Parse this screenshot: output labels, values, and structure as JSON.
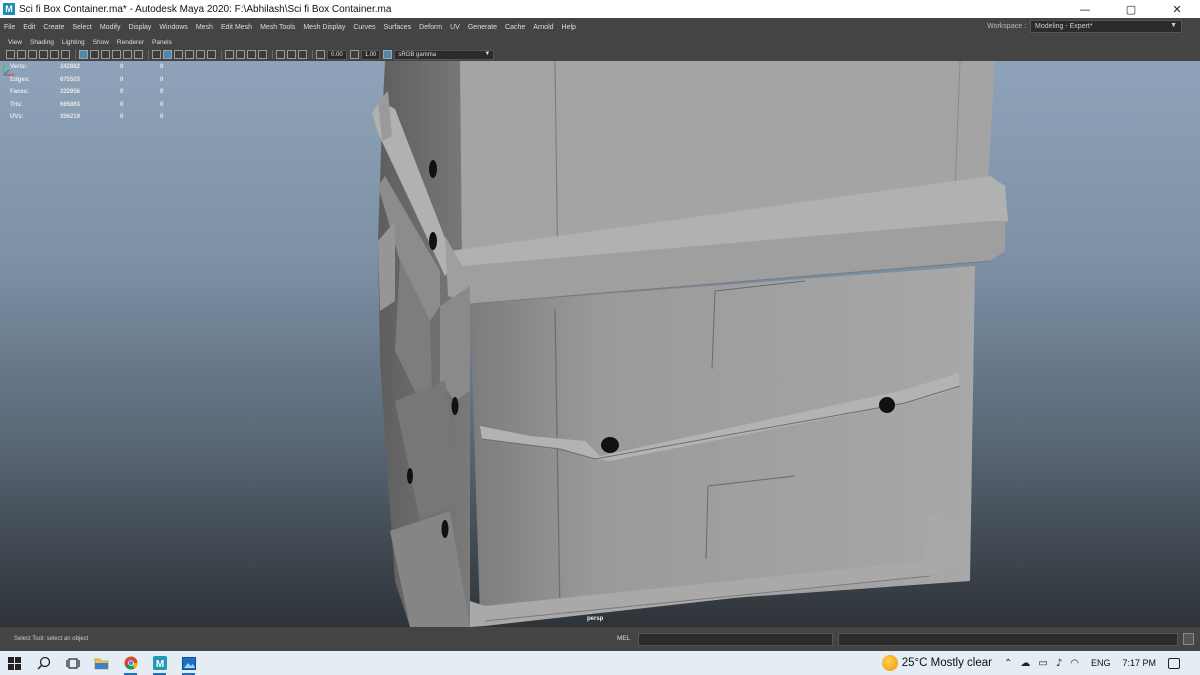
{
  "window": {
    "title": "Sci fi Box Container.ma* - Autodesk Maya 2020: F:\\Abhilash\\Sci fi Box Container.ma",
    "app_icon": "M",
    "minimize": "—",
    "maximize": "▢",
    "close": "✕"
  },
  "menubar": {
    "items": [
      "File",
      "Edit",
      "Create",
      "Select",
      "Modify",
      "Display",
      "Windows",
      "Mesh",
      "Edit Mesh",
      "Mesh Tools",
      "Mesh Display",
      "Curves",
      "Surfaces",
      "Deform",
      "UV",
      "Generate",
      "Cache",
      "Arnold",
      "Help"
    ],
    "workspace_label": "Workspace :",
    "workspace_value": "Modeling - Expert*"
  },
  "panel_menus": [
    "View",
    "Shading",
    "Lighting",
    "Show",
    "Renderer",
    "Panels"
  ],
  "panel_toolbar": {
    "exposure": "0.00",
    "gamma": "1.00",
    "color_space": "sRGB gamma"
  },
  "hud": {
    "rows": [
      {
        "label": "Verts:",
        "value": "342862",
        "sel": "0",
        "extra": "0"
      },
      {
        "label": "Edges:",
        "value": "675503",
        "sel": "0",
        "extra": "0"
      },
      {
        "label": "Faces:",
        "value": "332956",
        "sel": "0",
        "extra": "0"
      },
      {
        "label": "Tris:",
        "value": "665863",
        "sel": "0",
        "extra": "0"
      },
      {
        "label": "UVs:",
        "value": "356219",
        "sel": "0",
        "extra": "0"
      }
    ]
  },
  "viewport": {
    "camera": "persp",
    "background_top": "#8ea3b9",
    "background_bottom": "#2e3338",
    "model_color": "#9d9d9d"
  },
  "commandline": {
    "help": "Select Tool: select an object",
    "mel_label": "MEL"
  },
  "taskbar": {
    "icons": [
      "windows-start-icon",
      "search-icon",
      "task-view-icon",
      "file-explorer-icon",
      "chrome-icon",
      "maya-icon",
      "photos-icon"
    ],
    "weather": "25°C  Mostly clear",
    "language": "ENG",
    "time": "7:17 PM"
  }
}
